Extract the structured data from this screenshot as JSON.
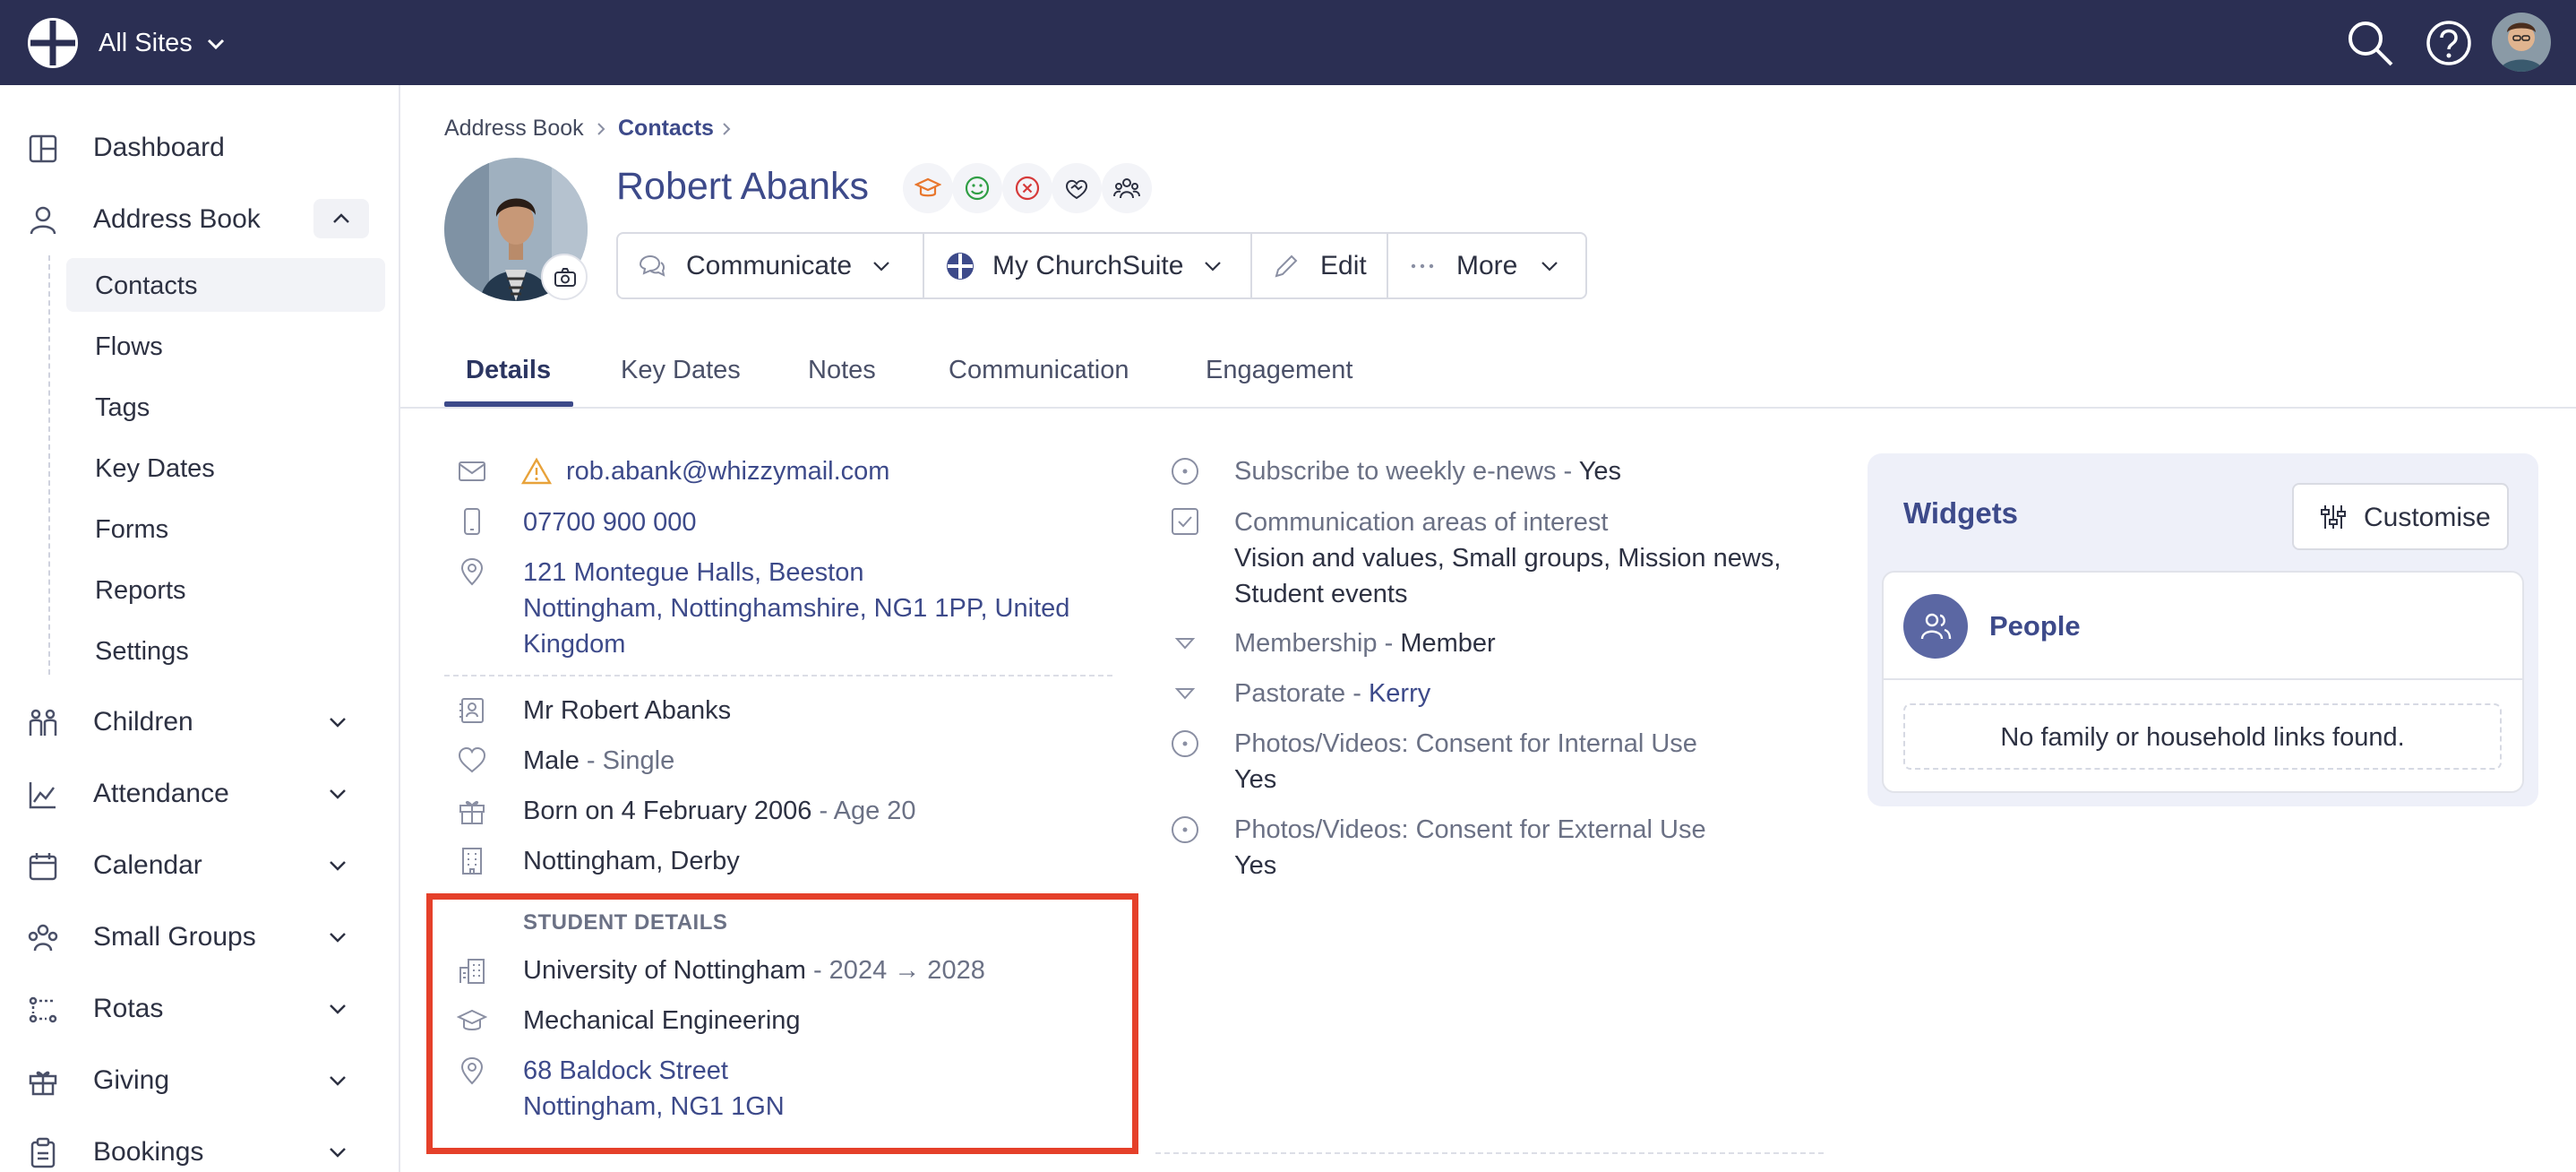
{
  "topbar": {
    "site_selector": "All Sites"
  },
  "sidebar": {
    "items": [
      {
        "label": "Dashboard",
        "icon": "dashboard-icon"
      },
      {
        "label": "Address Book",
        "icon": "person-icon"
      },
      {
        "label": "Children",
        "icon": "children-icon"
      },
      {
        "label": "Attendance",
        "icon": "chart-icon"
      },
      {
        "label": "Calendar",
        "icon": "calendar-icon"
      },
      {
        "label": "Small Groups",
        "icon": "group-icon"
      },
      {
        "label": "Rotas",
        "icon": "rotas-icon"
      },
      {
        "label": "Giving",
        "icon": "gift-icon"
      },
      {
        "label": "Bookings",
        "icon": "clipboard-icon"
      }
    ],
    "address_book_sub": [
      "Contacts",
      "Flows",
      "Tags",
      "Key Dates",
      "Forms",
      "Reports",
      "Settings"
    ],
    "active_sub": "Contacts"
  },
  "breadcrumb": {
    "parent": "Address Book",
    "current": "Contacts"
  },
  "contact": {
    "name": "Robert Abanks"
  },
  "tags": [
    "student-icon",
    "smile-icon",
    "cancel-icon",
    "handshake-icon",
    "people-icon"
  ],
  "colors": {
    "primary": "#3d4a8a",
    "topbar": "#2b2f53",
    "highlight": "#e5402a",
    "widget_bg": "#eef0f9"
  },
  "actions": {
    "communicate": "Communicate",
    "mychurchsuite": "My ChurchSuite",
    "edit": "Edit",
    "more": "More"
  },
  "tabs": [
    "Details",
    "Key Dates",
    "Notes",
    "Communication",
    "Engagement"
  ],
  "details": {
    "email": "rob.abank@whizzymail.com",
    "phone": "07700 900 000",
    "address": [
      "121 Montegue Halls, Beeston",
      "Nottingham, Nottinghamshire, NG1 1PP, United",
      "Kingdom"
    ],
    "full_name": "Mr Robert Abanks",
    "sex": "Male",
    "marital": "- Single",
    "born": "Born on 4 February 2006",
    "age": "- Age 20",
    "site": "Nottingham, Derby"
  },
  "student": {
    "section_title": "STUDENT DETAILS",
    "university": "University of Nottingham",
    "years": "- 2024 → 2028",
    "course": "Mechanical Engineering",
    "address_line1": "68 Baldock Street",
    "address_line2": "Nottingham, NG1 1GN"
  },
  "custom_fields": {
    "enews_label": "Subscribe to weekly e-news",
    "enews_value": "Yes",
    "interest_label": "Communication areas of interest",
    "interest_value_1": "Vision and values, Small groups, Mission news,",
    "interest_value_2": "Student events",
    "membership_label": "Membership",
    "membership_value": "Member",
    "pastorate_label": "Pastorate",
    "pastorate_value": "Kerry",
    "consent_internal_label": "Photos/Videos: Consent for Internal Use",
    "consent_internal_value": "Yes",
    "consent_external_label": "Photos/Videos: Consent for External Use",
    "consent_external_value": "Yes",
    "separator": "-"
  },
  "widgets": {
    "title": "Widgets",
    "customise": "Customise",
    "people_title": "People",
    "people_empty": "No family or household links found."
  }
}
